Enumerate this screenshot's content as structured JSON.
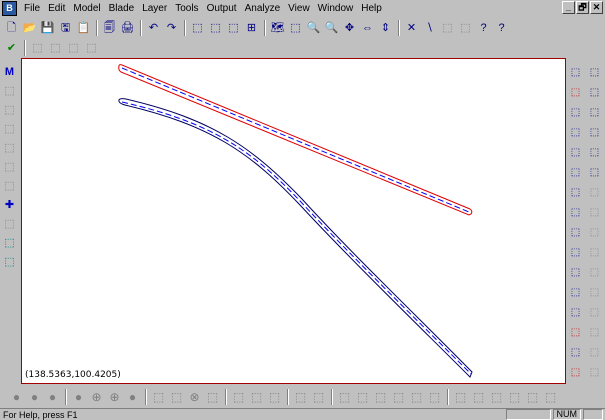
{
  "menubar": {
    "items": [
      "File",
      "Edit",
      "Model",
      "Blade",
      "Layer",
      "Tools",
      "Output",
      "Analyze",
      "View",
      "Window",
      "Help"
    ],
    "window_controls": [
      "_",
      "🗗",
      "✕"
    ]
  },
  "toolbar1": [
    "🗋",
    "📂",
    "💾",
    "🖫",
    "📋",
    "🗐",
    "🖨",
    "↶",
    "↷",
    "⬚",
    "⬚",
    "⬚",
    "⊞",
    "🗺",
    "⬚",
    "🔍",
    "🔍",
    "✥",
    "⇔",
    "⇕",
    "✕",
    "∖",
    "⬚",
    "⬚",
    "?",
    "?"
  ],
  "toolbar2": [
    "✔",
    "⬚",
    "⬚",
    "⬚",
    "⬚"
  ],
  "left_tools": [
    "M",
    "⬚",
    "⬚",
    "⬚",
    "⬚",
    "⬚",
    "⬚",
    "✚",
    "⬚",
    "⬚",
    "⬚"
  ],
  "right_tools": [
    "⬚",
    "⬚",
    "⬚",
    "⬚",
    "⬚",
    "⬚",
    "⬚",
    "⬚",
    "⬚",
    "⬚",
    "⬚",
    "⬚",
    "⬚",
    "⬚",
    "⬚",
    "⬚",
    "⬚",
    "⬚",
    "⬚",
    "⬚",
    "⬚",
    "⬚",
    "⬚",
    "⬚",
    "⬚",
    "⬚",
    "⬚",
    "⬚",
    "⬚",
    "⬚",
    "⬚",
    "⬚"
  ],
  "canvas": {
    "coordinate_readout": "(138.5363,100.4205)"
  },
  "bottom_tools": [
    "●",
    "●",
    "●",
    "●",
    "⊕",
    "⊕",
    "●",
    "⬚",
    "⬚",
    "⊗",
    "⬚",
    "⬚",
    "⬚",
    "⬚",
    "⬚",
    "⬚",
    "⬚",
    "⬚",
    "⬚",
    "⬚",
    "⬚",
    "⬚",
    "⬚",
    "⬚",
    "⬚",
    "⬚",
    "⬚",
    "⬚",
    "⬚",
    "⬚"
  ],
  "status": {
    "help_text": "For Help, press F1",
    "num_indicator": "NUM"
  }
}
